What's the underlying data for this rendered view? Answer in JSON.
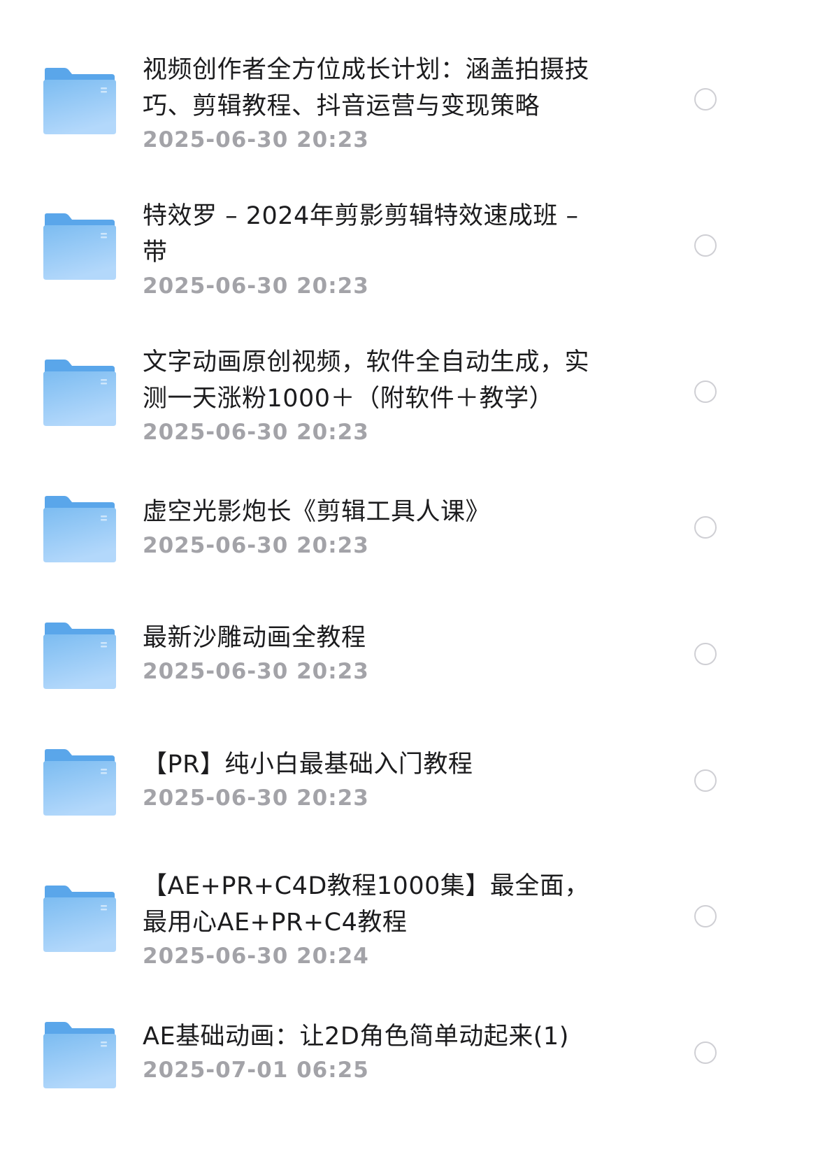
{
  "files": [
    {
      "icon": "folder-icon",
      "title_lines": [
        "视频创作者全方位成长计划：涵盖拍摄技",
        "巧、剪辑教程、抖音运营与变现策略"
      ],
      "date": "2025-06-30 20:23",
      "selected": false
    },
    {
      "icon": "folder-icon",
      "title_lines": [
        "特效罗 – 2024年剪影剪辑特效速成班 –",
        "带"
      ],
      "date": "2025-06-30 20:23",
      "selected": false
    },
    {
      "icon": "folder-icon",
      "title_lines": [
        "文字动画原创视频，软件全自动生成，实",
        "测一天涨粉1000＋（附软件＋教学）"
      ],
      "date": "2025-06-30 20:23",
      "selected": false
    },
    {
      "icon": "folder-icon",
      "title_lines": [
        "虚空光影炮长《剪辑工具人课》"
      ],
      "date": "2025-06-30 20:23",
      "selected": false
    },
    {
      "icon": "folder-icon",
      "title_lines": [
        "最新沙雕动画全教程"
      ],
      "date": "2025-06-30 20:23",
      "selected": false
    },
    {
      "icon": "folder-icon",
      "title_lines": [
        "【PR】纯小白最基础入门教程"
      ],
      "date": "2025-06-30 20:23",
      "selected": false
    },
    {
      "icon": "folder-icon",
      "title_lines": [
        "【AE+PR+C4D教程1000集】最全面，",
        "最用心AE+PR+C4教程"
      ],
      "date": "2025-06-30 20:24",
      "selected": false
    },
    {
      "icon": "folder-icon",
      "title_lines": [
        "AE基础动画：让2D角色简单动起来(1)"
      ],
      "date": "2025-07-01 06:25",
      "selected": false
    }
  ],
  "colors": {
    "folder_back": "#5aa6ea",
    "folder_front_top": "#7cbcf1",
    "folder_front_bottom": "#b3d8fb",
    "title_text": "#1c1c1e",
    "date_text": "#a3a3a8",
    "radio_border": "#cfcfd4"
  }
}
